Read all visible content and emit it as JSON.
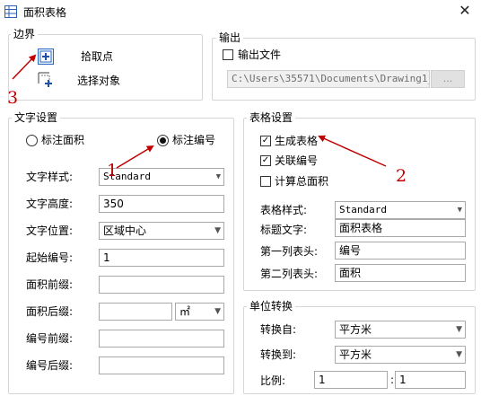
{
  "window": {
    "title": "面积表格",
    "close_symbol": "✕"
  },
  "boundary": {
    "title": "边界",
    "pick_point_label": "拾取点",
    "select_object_label": "选择对象"
  },
  "output": {
    "title": "输出",
    "output_file_label": "输出文件",
    "output_file_checked": false,
    "path_value": "C:\\Users\\35571\\Documents\\Drawing1_",
    "browse_label": "..."
  },
  "text_settings": {
    "title": "文字设置",
    "radio_area_label": "标注面积",
    "radio_number_label": "标注编号",
    "selected": "标注编号",
    "fields": [
      {
        "label": "文字样式:",
        "value": "Standard",
        "kind": "select"
      },
      {
        "label": "文字高度:",
        "value": "350",
        "kind": "input"
      },
      {
        "label": "文字位置:",
        "value": "区域中心",
        "kind": "select"
      },
      {
        "label": "起始编号:",
        "value": "1",
        "kind": "input"
      },
      {
        "label": "面积前缀:",
        "value": "",
        "kind": "input"
      },
      {
        "label": "面积后缀:",
        "value": "",
        "kind": "input"
      },
      {
        "label": "编号前缀:",
        "value": "",
        "kind": "input"
      },
      {
        "label": "编号后缀:",
        "value": "",
        "kind": "input"
      }
    ],
    "unit_select_value": "㎡"
  },
  "table_settings": {
    "title": "表格设置",
    "generate_table_label": "生成表格",
    "generate_table_checked": true,
    "link_number_label": "关联编号",
    "link_number_checked": true,
    "total_area_label": "计算总面积",
    "total_area_checked": false,
    "fields": [
      {
        "label": "表格样式:",
        "value": "Standard",
        "kind": "select"
      },
      {
        "label": "标题文字:",
        "value": "面积表格",
        "kind": "input"
      },
      {
        "label": "第一列表头:",
        "value": "编号",
        "kind": "input"
      },
      {
        "label": "第二列表头:",
        "value": "面积",
        "kind": "input"
      }
    ]
  },
  "unit_conversion": {
    "title": "单位转换",
    "from_label": "转换自:",
    "from_value": "平方米",
    "to_label": "转换到:",
    "to_value": "平方米",
    "ratio_label": "比例:",
    "ratio_left": "1",
    "ratio_separator": ":",
    "ratio_right": "1"
  },
  "annotations": {
    "n1": "1",
    "n2": "2",
    "n3": "3",
    "color": "#c00000"
  }
}
